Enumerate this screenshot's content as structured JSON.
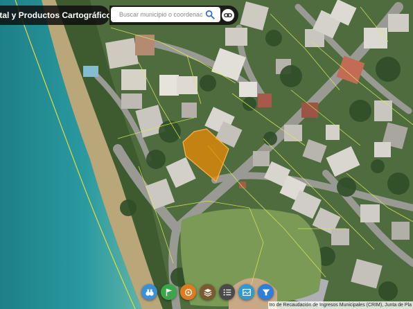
{
  "header": {
    "app_title": "ital y Productos Cartográficos"
  },
  "search": {
    "placeholder": "Buscar municipio o coordenada",
    "value": ""
  },
  "toolbar": {
    "tools": [
      {
        "name": "binoculars-icon",
        "color": "#3a8fd6"
      },
      {
        "name": "flag-icon",
        "color": "#3aa84a"
      },
      {
        "name": "ruler-icon",
        "color": "#e07a1f"
      },
      {
        "name": "layers-icon",
        "color": "#7a5a2e"
      },
      {
        "name": "list-icon",
        "color": "#4a4a4a"
      },
      {
        "name": "map-info-icon",
        "color": "#2f9ad0"
      },
      {
        "name": "filter-icon",
        "color": "#2f7fd6"
      }
    ]
  },
  "attribution": {
    "text": "tro de Recaudación de Ingresos Municipales (CRIM), Junta de Pla"
  },
  "colors": {
    "selected_parcel": "#f08a00",
    "parcel_lines": "#d8e85a",
    "shore_line": "#e0dc3c",
    "sea": "#1f8f95"
  }
}
